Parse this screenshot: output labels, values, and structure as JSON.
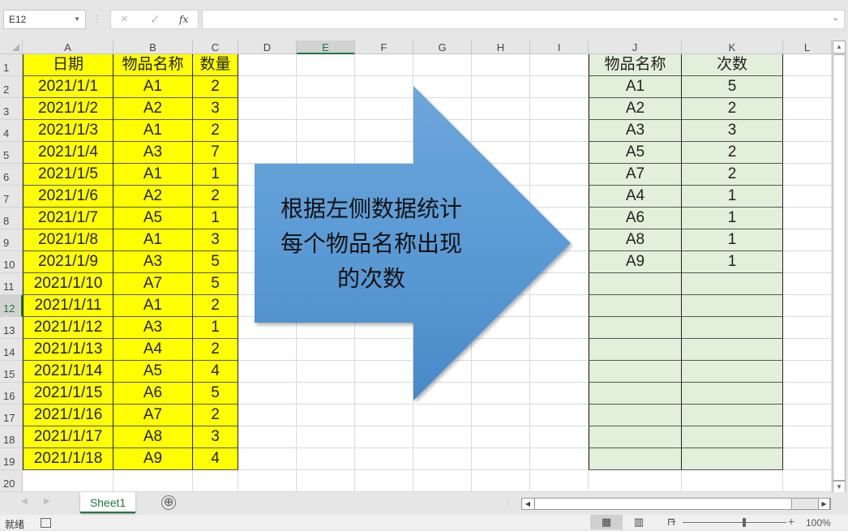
{
  "formula_bar": {
    "name_box": "E12",
    "cancel_icon": "×",
    "enter_icon": "✓",
    "fx_label": "fx",
    "formula": ""
  },
  "columns": [
    "A",
    "B",
    "C",
    "D",
    "E",
    "F",
    "G",
    "H",
    "I",
    "J",
    "K",
    "L"
  ],
  "selected_column": "E",
  "selected_row": "12",
  "rows": [
    "1",
    "2",
    "3",
    "4",
    "5",
    "6",
    "7",
    "8",
    "9",
    "10",
    "11",
    "12",
    "13",
    "14",
    "15",
    "16",
    "17",
    "18",
    "19",
    "20"
  ],
  "source_table": {
    "headers": [
      "日期",
      "物品名称",
      "数量"
    ],
    "rows": [
      [
        "2021/1/1",
        "A1",
        "2"
      ],
      [
        "2021/1/2",
        "A2",
        "3"
      ],
      [
        "2021/1/3",
        "A1",
        "2"
      ],
      [
        "2021/1/4",
        "A3",
        "7"
      ],
      [
        "2021/1/5",
        "A1",
        "1"
      ],
      [
        "2021/1/6",
        "A2",
        "2"
      ],
      [
        "2021/1/7",
        "A5",
        "1"
      ],
      [
        "2021/1/8",
        "A1",
        "3"
      ],
      [
        "2021/1/9",
        "A3",
        "5"
      ],
      [
        "2021/1/10",
        "A7",
        "5"
      ],
      [
        "2021/1/11",
        "A1",
        "2"
      ],
      [
        "2021/1/12",
        "A3",
        "1"
      ],
      [
        "2021/1/13",
        "A4",
        "2"
      ],
      [
        "2021/1/14",
        "A5",
        "4"
      ],
      [
        "2021/1/15",
        "A6",
        "5"
      ],
      [
        "2021/1/16",
        "A7",
        "2"
      ],
      [
        "2021/1/17",
        "A8",
        "3"
      ],
      [
        "2021/1/18",
        "A9",
        "4"
      ]
    ],
    "fill_color": "#ffff00"
  },
  "result_table": {
    "headers": [
      "物品名称",
      "次数"
    ],
    "rows": [
      [
        "A1",
        "5"
      ],
      [
        "A2",
        "2"
      ],
      [
        "A3",
        "3"
      ],
      [
        "A5",
        "2"
      ],
      [
        "A7",
        "2"
      ],
      [
        "A4",
        "1"
      ],
      [
        "A6",
        "1"
      ],
      [
        "A8",
        "1"
      ],
      [
        "A9",
        "1"
      ],
      [
        "",
        ""
      ],
      [
        "",
        ""
      ],
      [
        "",
        ""
      ],
      [
        "",
        ""
      ],
      [
        "",
        ""
      ],
      [
        "",
        ""
      ],
      [
        "",
        ""
      ],
      [
        "",
        ""
      ],
      [
        "",
        ""
      ]
    ],
    "fill_color": "#e2efda"
  },
  "arrow_shape": {
    "text_lines": [
      "根据左侧数据统计",
      "每个物品名称出现",
      "的次数"
    ],
    "color": "#5b9bd5"
  },
  "sheet_tabs": [
    {
      "label": "Sheet1",
      "active": true
    }
  ],
  "add_sheet_icon": "⊕",
  "status_bar": {
    "status": "就绪",
    "zoom_level": "100%",
    "zoom_percent": 100
  }
}
